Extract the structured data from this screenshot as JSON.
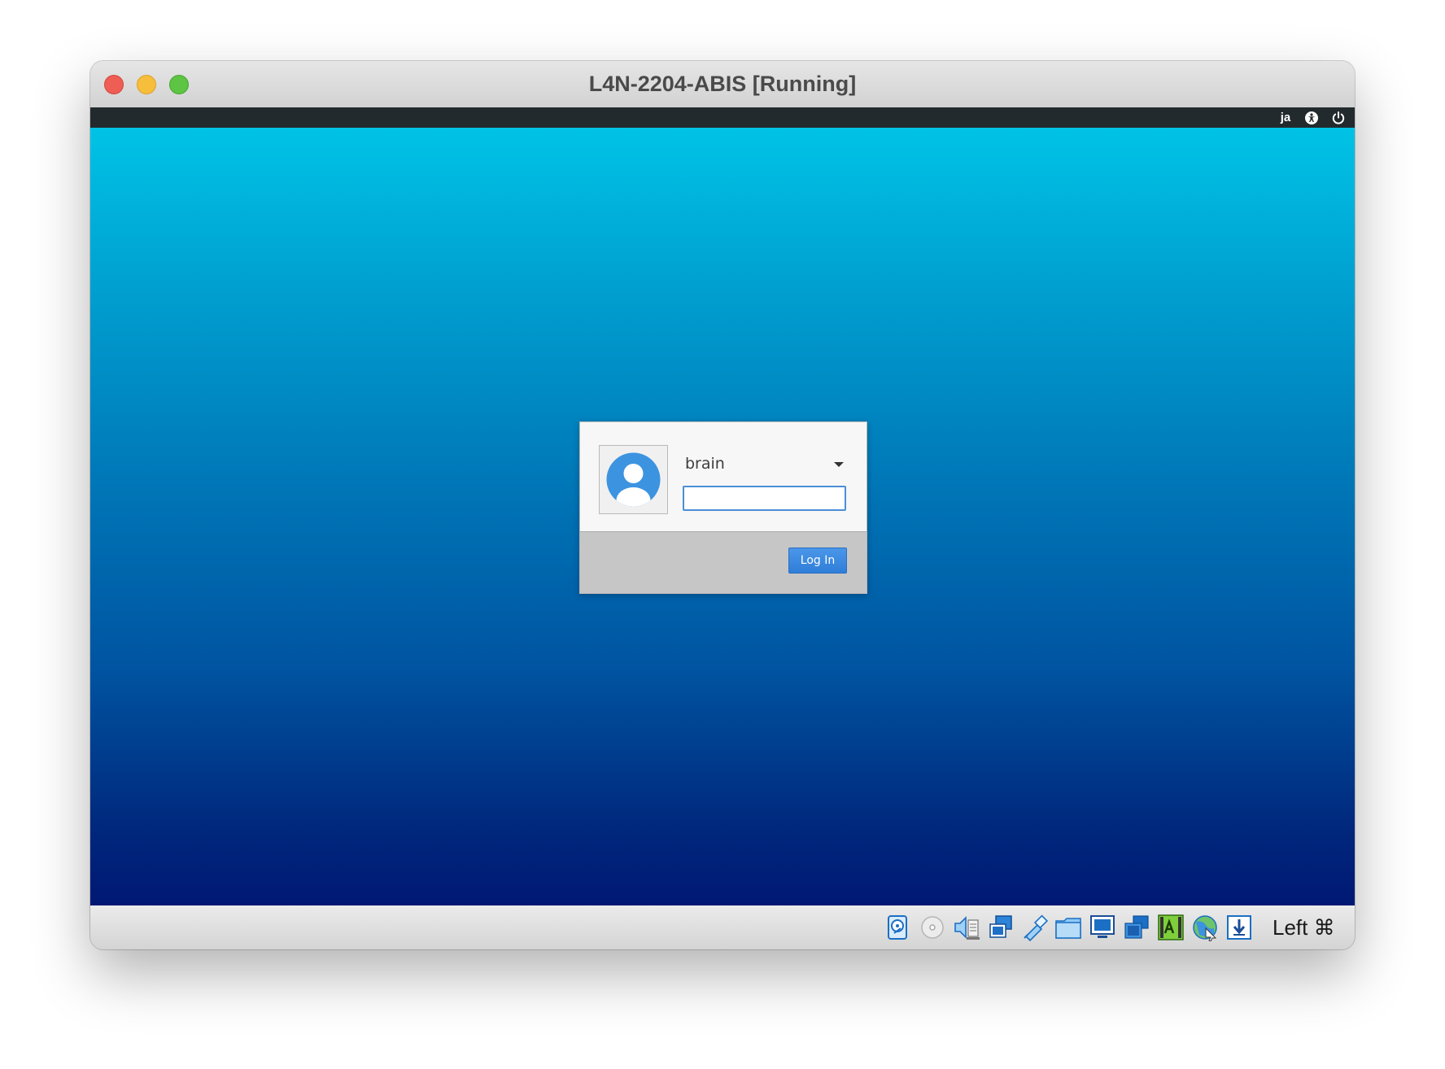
{
  "window": {
    "title": "L4N-2204-ABIS [Running]",
    "traffic_lights": [
      "close",
      "minimize",
      "zoom"
    ]
  },
  "guest_topbar": {
    "keyboard_layout": "ja",
    "icons": [
      "accessibility-icon",
      "power-icon"
    ]
  },
  "login": {
    "username": "brain",
    "password_value": "",
    "password_placeholder": "",
    "login_button_label": "Log In",
    "avatar": "user-avatar-icon"
  },
  "statusbar": {
    "icons": [
      "hard-disk-icon",
      "optical-drive-icon",
      "audio-icon",
      "network-icon",
      "usb-icon",
      "shared-folders-icon",
      "display-icon",
      "video-capture-icon",
      "recording-icon",
      "mouse-integration-icon",
      "host-key-status-icon"
    ],
    "host_key": "Left ⌘"
  },
  "colors": {
    "accent": "#3584e4",
    "desktop_top": "#00c3e6",
    "desktop_bottom": "#001874",
    "topbar": "#222a2d"
  }
}
